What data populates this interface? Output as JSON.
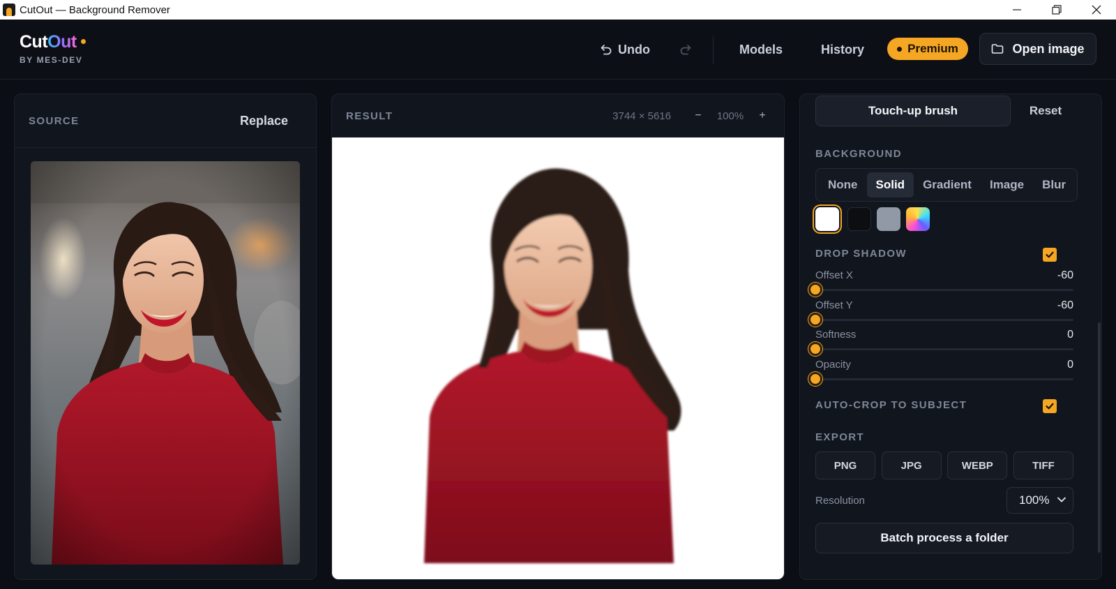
{
  "window": {
    "title": "CutOut — Background Remover",
    "controls": [
      "minimize-icon",
      "restore-icon",
      "close-icon"
    ]
  },
  "brand": {
    "name_part1": "Cut",
    "name_part2": "Out",
    "subtitle": "BY MES-DEV",
    "accent": "#f5a623"
  },
  "header": {
    "undo_label": "Undo",
    "models_label": "Models",
    "history_label": "History",
    "premium_label": "Premium",
    "open_image_label": "Open image"
  },
  "source_panel": {
    "title": "SOURCE",
    "replace_label": "Replace"
  },
  "result_panel": {
    "title": "RESULT",
    "dimensions": "3744 × 5616",
    "zoom_out": "−",
    "zoom_level": "100%",
    "zoom_in": "+"
  },
  "tools": {
    "brush_label": "Touch-up brush",
    "reset_label": "Reset"
  },
  "background": {
    "label": "BACKGROUND",
    "options": [
      "None",
      "Solid",
      "Gradient",
      "Image",
      "Blur"
    ],
    "selected": "Solid",
    "swatches": [
      {
        "name": "white",
        "color": "#ffffff",
        "selected": true
      },
      {
        "name": "black",
        "color": "#0c0e12",
        "selected": false
      },
      {
        "name": "gray",
        "color": "#9199a6",
        "selected": false
      },
      {
        "name": "gradient",
        "color": "multicolor",
        "selected": false
      }
    ]
  },
  "drop_shadow": {
    "label": "DROP SHADOW",
    "enabled": true,
    "sliders": [
      {
        "label": "Offset X",
        "value": "-60",
        "fraction": 0.0
      },
      {
        "label": "Offset Y",
        "value": "-60",
        "fraction": 0.0
      },
      {
        "label": "Softness",
        "value": "0",
        "fraction": 0.0
      },
      {
        "label": "Opacity",
        "value": "0",
        "fraction": 0.0
      }
    ]
  },
  "autocrop": {
    "label": "AUTO-CROP TO SUBJECT",
    "enabled": true
  },
  "export": {
    "label": "EXPORT",
    "formats": [
      "PNG",
      "JPG",
      "WEBP",
      "TIFF"
    ],
    "resolution_label": "Resolution",
    "resolution_value": "100%",
    "batch_label": "Batch process a folder"
  }
}
